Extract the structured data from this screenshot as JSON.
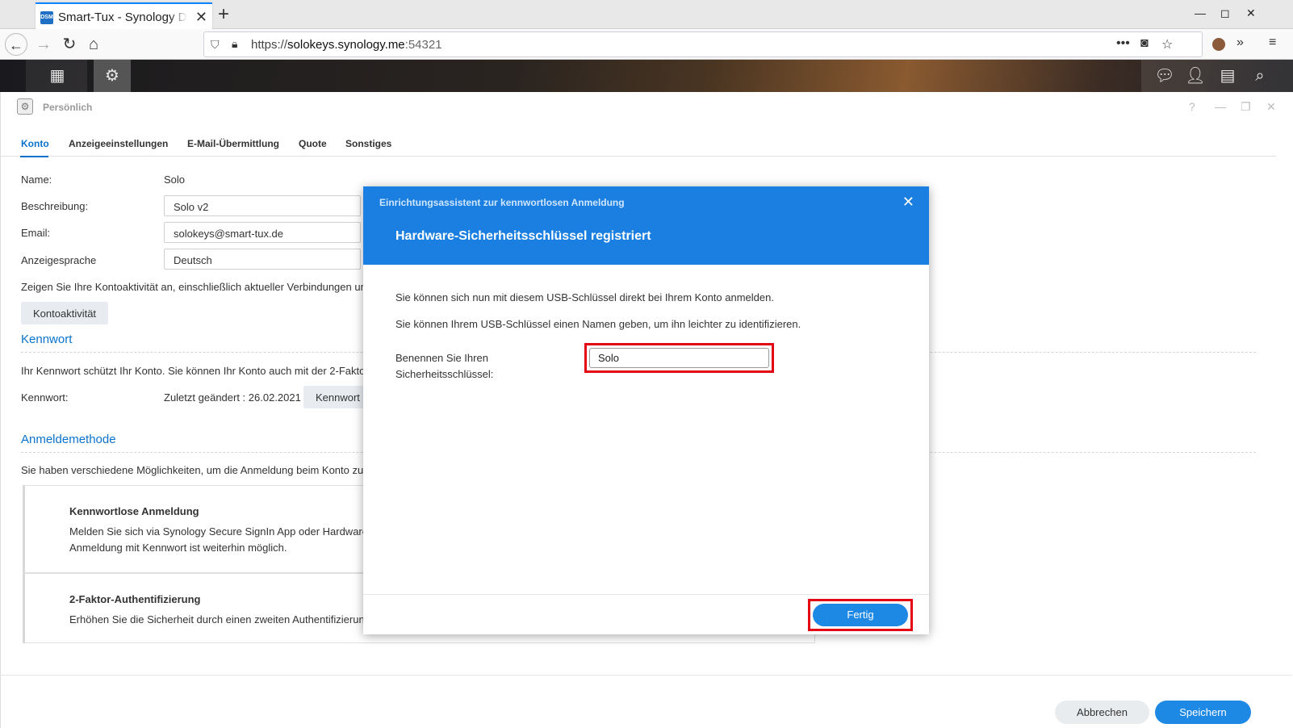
{
  "browser": {
    "tab_title": "Smart-Tux - Synology Dis",
    "favicon_text": "DSM",
    "url_prefix": "https://",
    "url_domain": "solokeys.synology.me",
    "url_port": ":54321"
  },
  "window": {
    "title": "Persönlich",
    "tabs": [
      {
        "label": "Konto"
      },
      {
        "label": "Anzeigeeinstellungen"
      },
      {
        "label": "E-Mail-Übermittlung"
      },
      {
        "label": "Quote"
      },
      {
        "label": "Sonstiges"
      }
    ]
  },
  "account": {
    "name_label": "Name:",
    "name_value": "Solo",
    "description_label": "Beschreibung:",
    "description_value": "Solo v2",
    "email_label": "Email:",
    "email_value": "solokeys@smart-tux.de",
    "language_label": "Anzeigesprache",
    "language_value": "Deutsch",
    "activity_text": "Zeigen Sie Ihre Kontoaktivität an, einschließlich aktueller Verbindungen un",
    "activity_button": "Kontoaktivität"
  },
  "password": {
    "section_title": "Kennwort",
    "info_text": "Ihr Kennwort schützt Ihr Konto. Sie können Ihr Konto auch mit der 2-Fakto",
    "label": "Kennwort:",
    "last_changed": "Zuletzt geändert : 26.02.2021",
    "button": "Kennwort"
  },
  "login_method": {
    "section_title": "Anmeldemethode",
    "info_text": "Sie haben verschiedene Möglichkeiten, um die Anmeldung beim Konto zu",
    "cards": [
      {
        "title": "Kennwortlose Anmeldung",
        "line1": "Melden Sie sich via Synology Secure SignIn App oder Hardware",
        "line2": "Anmeldung mit Kennwort ist weiterhin möglich."
      },
      {
        "title": "2-Faktor-Authentifizierung",
        "line1": "Erhöhen Sie die Sicherheit durch einen zweiten Authentifizierungsschritt."
      }
    ]
  },
  "footer": {
    "cancel": "Abbrechen",
    "save": "Speichern"
  },
  "dialog": {
    "subtitle": "Einrichtungsassistent zur kennwortlosen Anmeldung",
    "title": "Hardware-Sicherheitsschlüssel registriert",
    "paragraph1": "Sie können sich nun mit diesem USB-Schlüssel direkt bei Ihrem Konto anmelden.",
    "paragraph2": "Sie können Ihrem USB-Schlüssel einen Namen geben, um ihn leichter zu identifizieren.",
    "name_label": "Benennen Sie Ihren Sicherheitsschlüssel:",
    "name_value": "Solo",
    "done_button": "Fertig",
    "highlight_color": "#e30613"
  },
  "colors": {
    "accent": "#0a72cc",
    "dialog_header": "#1a7fe0",
    "primary_button": "#1e88e5"
  }
}
